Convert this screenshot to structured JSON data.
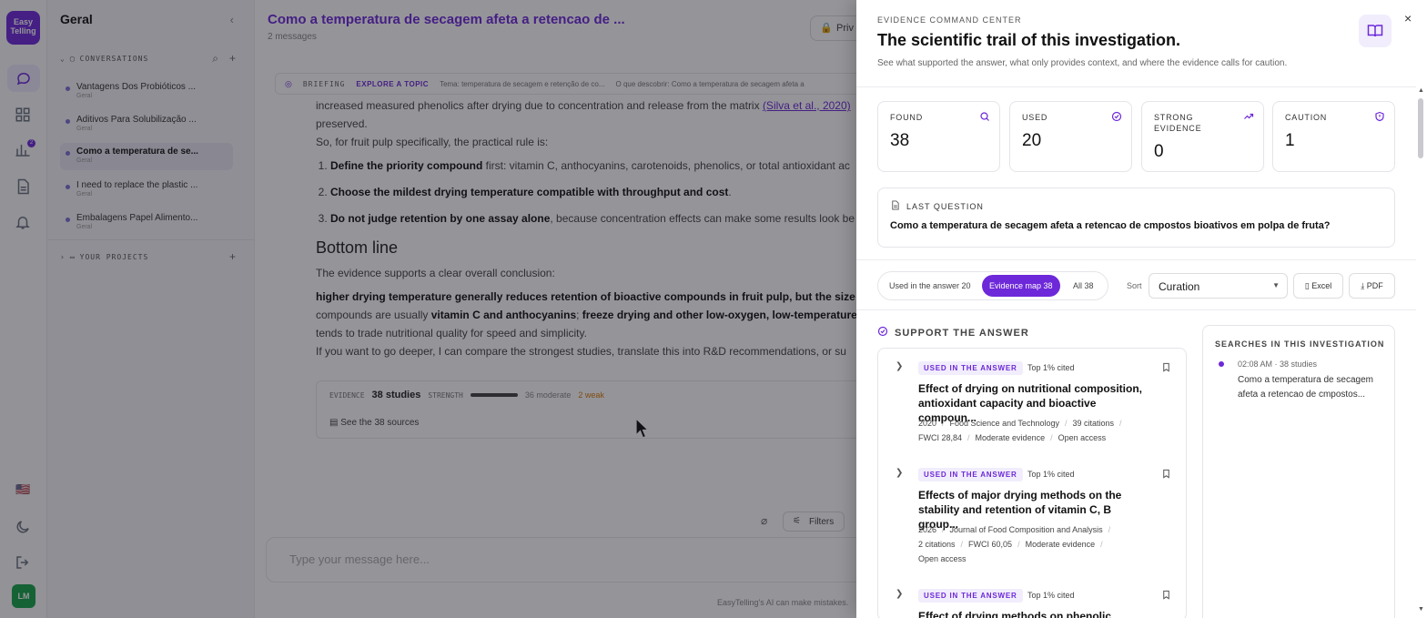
{
  "rail": {
    "logo_text": "Easy Telling",
    "badge_count": "2",
    "avatar_initials": "LM",
    "flag": "🇺🇸"
  },
  "sidebar": {
    "title": "Geral",
    "conversations_label": "CONVERSATIONS",
    "projects_label": "YOUR PROJECTS",
    "conversations": [
      {
        "title": "Vantagens Dos Probióticos ...",
        "sub": "Geral"
      },
      {
        "title": "Aditivos Para Solubilização ...",
        "sub": "Geral"
      },
      {
        "title": "Como a temperatura de se...",
        "sub": "Geral"
      },
      {
        "title": "I need to replace the plastic ...",
        "sub": "Geral"
      },
      {
        "title": "Embalagens Papel Alimento...",
        "sub": "Geral"
      }
    ]
  },
  "main": {
    "title": "Como a temperatura de secagem afeta a retencao de ...",
    "subtitle": "2 messages",
    "privacy_label": "Priv",
    "briefing": {
      "label": "BRIEFING",
      "explore": "EXPLORE A TOPIC",
      "chip1": "Tema: temperatura de secagem e retenção de co...",
      "chip2": "O que descobrir: Como a temperatura de secagem afeta a"
    },
    "message": {
      "l1a": "increased measured phenolics after drying due to concentration and release from the matrix ",
      "l1link": "(Silva et al., 2020)",
      "l2": "preserved.",
      "l3": "So, for fruit pulp specifically, the practical rule is:",
      "li1b": "Define the priority compound",
      "li1r": " first: vitamin C, anthocyanins, carotenoids, phenolics, or total antioxidant ac",
      "li2b": "Choose the mildest drying temperature compatible with throughput and cost",
      "li2r": ".",
      "li3b": "Do not judge retention by one assay alone",
      "li3r": ", because concentration effects can make some results look be",
      "heading": "Bottom line",
      "p1": "The evidence supports a clear overall conclusion:",
      "p2b": "higher drying temperature generally reduces retention of bioactive compounds in fruit pulp, but the size c",
      "p3a": "compounds are usually ",
      "p3b": "vitamin C and anthocyanins",
      "p3c": "; ",
      "p3d": "freeze drying and other low-oxygen, low-temperature",
      "p4": "tends to trade nutritional quality for speed and simplicity.",
      "p5": "If you want to go deeper, I can compare the strongest studies, translate this into R&D recommendations, or su"
    },
    "evidence": {
      "label": "EVIDENCE",
      "studies": "38 studies",
      "strength_label": "STRENGTH",
      "moderate": "36 moderate",
      "weak": "2 weak",
      "sources_link": "See the 38 sources"
    },
    "filters_label": "Filters",
    "composer_placeholder": "Type your message here...",
    "disclaimer": "EasyTelling's AI can make mistakes."
  },
  "drawer": {
    "kicker": "EVIDENCE COMMAND CENTER",
    "title": "The scientific trail of this investigation.",
    "description": "See what supported the answer, what only provides context, and where the evidence calls for caution.",
    "close": "×",
    "stats": [
      {
        "label": "FOUND",
        "value": "38"
      },
      {
        "label": "USED",
        "value": "20"
      },
      {
        "label": "STRONG EVIDENCE",
        "value": "0"
      },
      {
        "label": "CAUTION",
        "value": "1"
      }
    ],
    "last_question_label": "LAST QUESTION",
    "last_question": "Como a temperatura de secagem afeta a retencao de cmpostos bioativos em polpa de fruta?",
    "tabs": [
      {
        "label": "Used in the answer  20"
      },
      {
        "label": "Evidence map  38"
      },
      {
        "label": "All  38"
      }
    ],
    "sort_label": "Sort",
    "sort_value": "Curation",
    "excel_label": "Excel",
    "pdf_label": "PDF",
    "support_label": "SUPPORT THE ANSWER",
    "cards": [
      {
        "badge": "USED IN THE ANSWER",
        "top": "Top 1% cited",
        "title": "Effect of drying on nutritional composition, antioxidant capacity and bioactive compoun...",
        "meta_line1": [
          "2020",
          "Food Science and Technology",
          "39 citations"
        ],
        "meta_line2": [
          "FWCI 28,84",
          "Moderate evidence",
          "Open access"
        ]
      },
      {
        "badge": "USED IN THE ANSWER",
        "top": "Top 1% cited",
        "title": "Effects of major drying methods on the stability and retention of vitamin C, B group...",
        "meta_line1": [
          "2026",
          "Journal of Food Composition and Analysis"
        ],
        "meta_line2": [
          "2 citations",
          "FWCI 60,05",
          "Moderate evidence"
        ],
        "meta_line3": [
          "Open access"
        ]
      },
      {
        "badge": "USED IN THE ANSWER",
        "top": "Top 1% cited",
        "title": "Effect of drying methods on phenolic"
      }
    ],
    "searches_title": "SEARCHES IN THIS INVESTIGATION",
    "search_time": "02:08 AM · 38 studies",
    "search_query": "Como a temperatura de secagem afeta a retencao de cmpostos..."
  },
  "colors": {
    "accent": "#6d28d9",
    "accent_soft": "#f1edfc",
    "overlay": "rgba(20,20,28,0.45)"
  }
}
